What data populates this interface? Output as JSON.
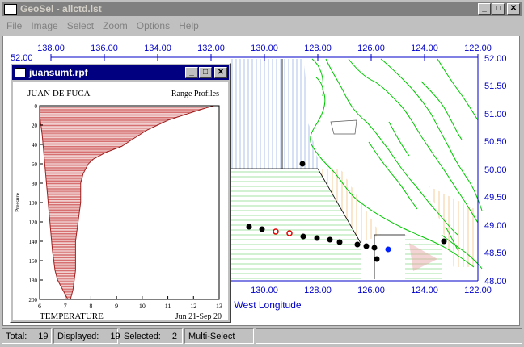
{
  "app": {
    "title": "GeoSel - allctd.lst",
    "window_buttons": [
      "_",
      "□",
      "✕"
    ]
  },
  "menu": [
    "File",
    "Image",
    "Select",
    "Zoom",
    "Options",
    "Help"
  ],
  "map": {
    "top_lon_ticks": [
      "138.00",
      "136.00",
      "134.00",
      "132.00",
      "130.00",
      "128.00",
      "126.00",
      "124.00",
      "122.00"
    ],
    "bottom_lon_ticks": [
      "130.00",
      "128.00",
      "126.00",
      "124.00",
      "122.00"
    ],
    "lat_ticks": [
      "52.00",
      "51.50",
      "51.00",
      "50.50",
      "50.00",
      "49.50",
      "49.00",
      "48.50",
      "48.00"
    ],
    "left_lat_label": "52.00",
    "xlabel": "West Longitude",
    "colors": {
      "axis": "#0000c8",
      "coast": "#00c800",
      "station": "#000000",
      "selected": "#e00000",
      "highlight": "#0020ff"
    }
  },
  "child_window": {
    "title": "juansumt.rpf",
    "buttons": [
      "_",
      "□",
      "✕"
    ],
    "plot_title_left": "JUAN DE FUCA",
    "plot_title_right": "Range Profiles",
    "bottom_left": "TEMPERATURE",
    "bottom_right": "Jun 21-Sep 20",
    "ylabel": "Pressure"
  },
  "chart_data": {
    "type": "area",
    "title": "JUAN DE FUCA",
    "xlabel": "TEMPERATURE",
    "ylabel": "Pressure",
    "x_ticks": [
      "6",
      "7",
      "8",
      "9",
      "10",
      "11",
      "12",
      "13"
    ],
    "y_ticks": [
      "0",
      "20",
      "40",
      "60",
      "80",
      "100",
      "120",
      "140",
      "160",
      "180",
      "200"
    ],
    "xlim": [
      6,
      13
    ],
    "ylim": [
      0,
      200
    ],
    "min_profile": [
      [
        6.0,
        2
      ],
      [
        6.0,
        10
      ],
      [
        6.1,
        30
      ],
      [
        6.2,
        60
      ],
      [
        6.3,
        90
      ],
      [
        6.4,
        120
      ],
      [
        6.5,
        150
      ],
      [
        6.6,
        170
      ],
      [
        6.7,
        180
      ],
      [
        6.9,
        190
      ],
      [
        7.1,
        200
      ]
    ],
    "max_profile": [
      [
        12.8,
        0
      ],
      [
        12.4,
        3
      ],
      [
        11.8,
        8
      ],
      [
        11.0,
        15
      ],
      [
        10.2,
        25
      ],
      [
        9.6,
        35
      ],
      [
        9.2,
        42
      ],
      [
        8.6,
        48
      ],
      [
        8.1,
        55
      ],
      [
        7.9,
        60
      ],
      [
        7.7,
        70
      ],
      [
        7.6,
        80
      ],
      [
        7.6,
        100
      ],
      [
        7.5,
        120
      ],
      [
        7.4,
        140
      ],
      [
        7.4,
        170
      ],
      [
        7.3,
        190
      ],
      [
        7.2,
        200
      ]
    ]
  },
  "status": {
    "total_label": "Total:",
    "total": "19",
    "displayed_label": "Displayed:",
    "displayed": "19",
    "selected_label": "Selected:",
    "selected": "2",
    "mode": "Multi-Select"
  }
}
